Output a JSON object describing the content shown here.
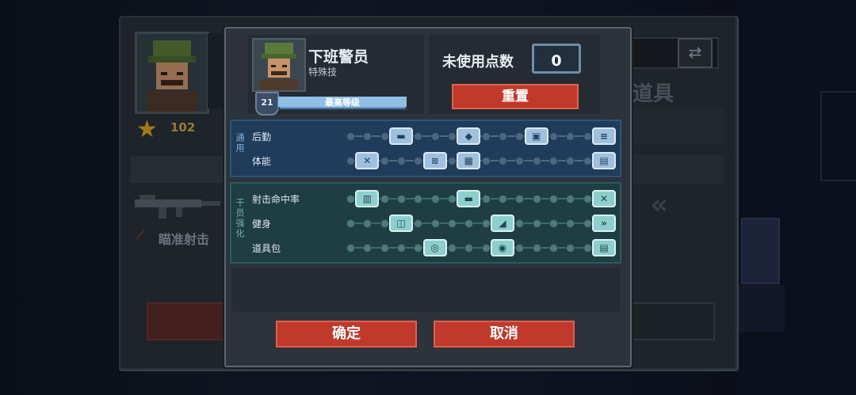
{
  "background": {
    "star_count": "102",
    "skill_name": "瞄准射击",
    "items_label": "道具",
    "swap_icon": "swap-icon",
    "chevron": "«"
  },
  "dialog": {
    "character": {
      "name": "下班警员",
      "subtitle": "特殊技",
      "level": "21",
      "level_text": "最高等级",
      "level_progress": 1.0
    },
    "points": {
      "label": "未使用点数",
      "value": "0",
      "reset_label": "重置"
    },
    "sections": [
      {
        "label": "通用",
        "rows": [
          {
            "label": "后勤",
            "nodes": [
              3,
              7,
              11,
              15
            ],
            "icons": [
              "▬",
              "◆",
              "▣",
              "≡"
            ]
          },
          {
            "label": "体能",
            "nodes": [
              1,
              5,
              7,
              15
            ],
            "icons": [
              "✕",
              "≋",
              "▦",
              "▤"
            ]
          }
        ]
      },
      {
        "label": "干员强化",
        "rows": [
          {
            "label": "射击命中率",
            "nodes": [
              1,
              7,
              15
            ],
            "icons": [
              "▥",
              "▬",
              "✕"
            ]
          },
          {
            "label": "健身",
            "nodes": [
              3,
              9,
              15
            ],
            "icons": [
              "◫",
              "◢",
              "»"
            ]
          },
          {
            "label": "道具包",
            "nodes": [
              5,
              9,
              15
            ],
            "icons": [
              "◎",
              "◉",
              "▤"
            ]
          }
        ]
      }
    ],
    "confirm_label": "确定",
    "cancel_label": "取消"
  }
}
